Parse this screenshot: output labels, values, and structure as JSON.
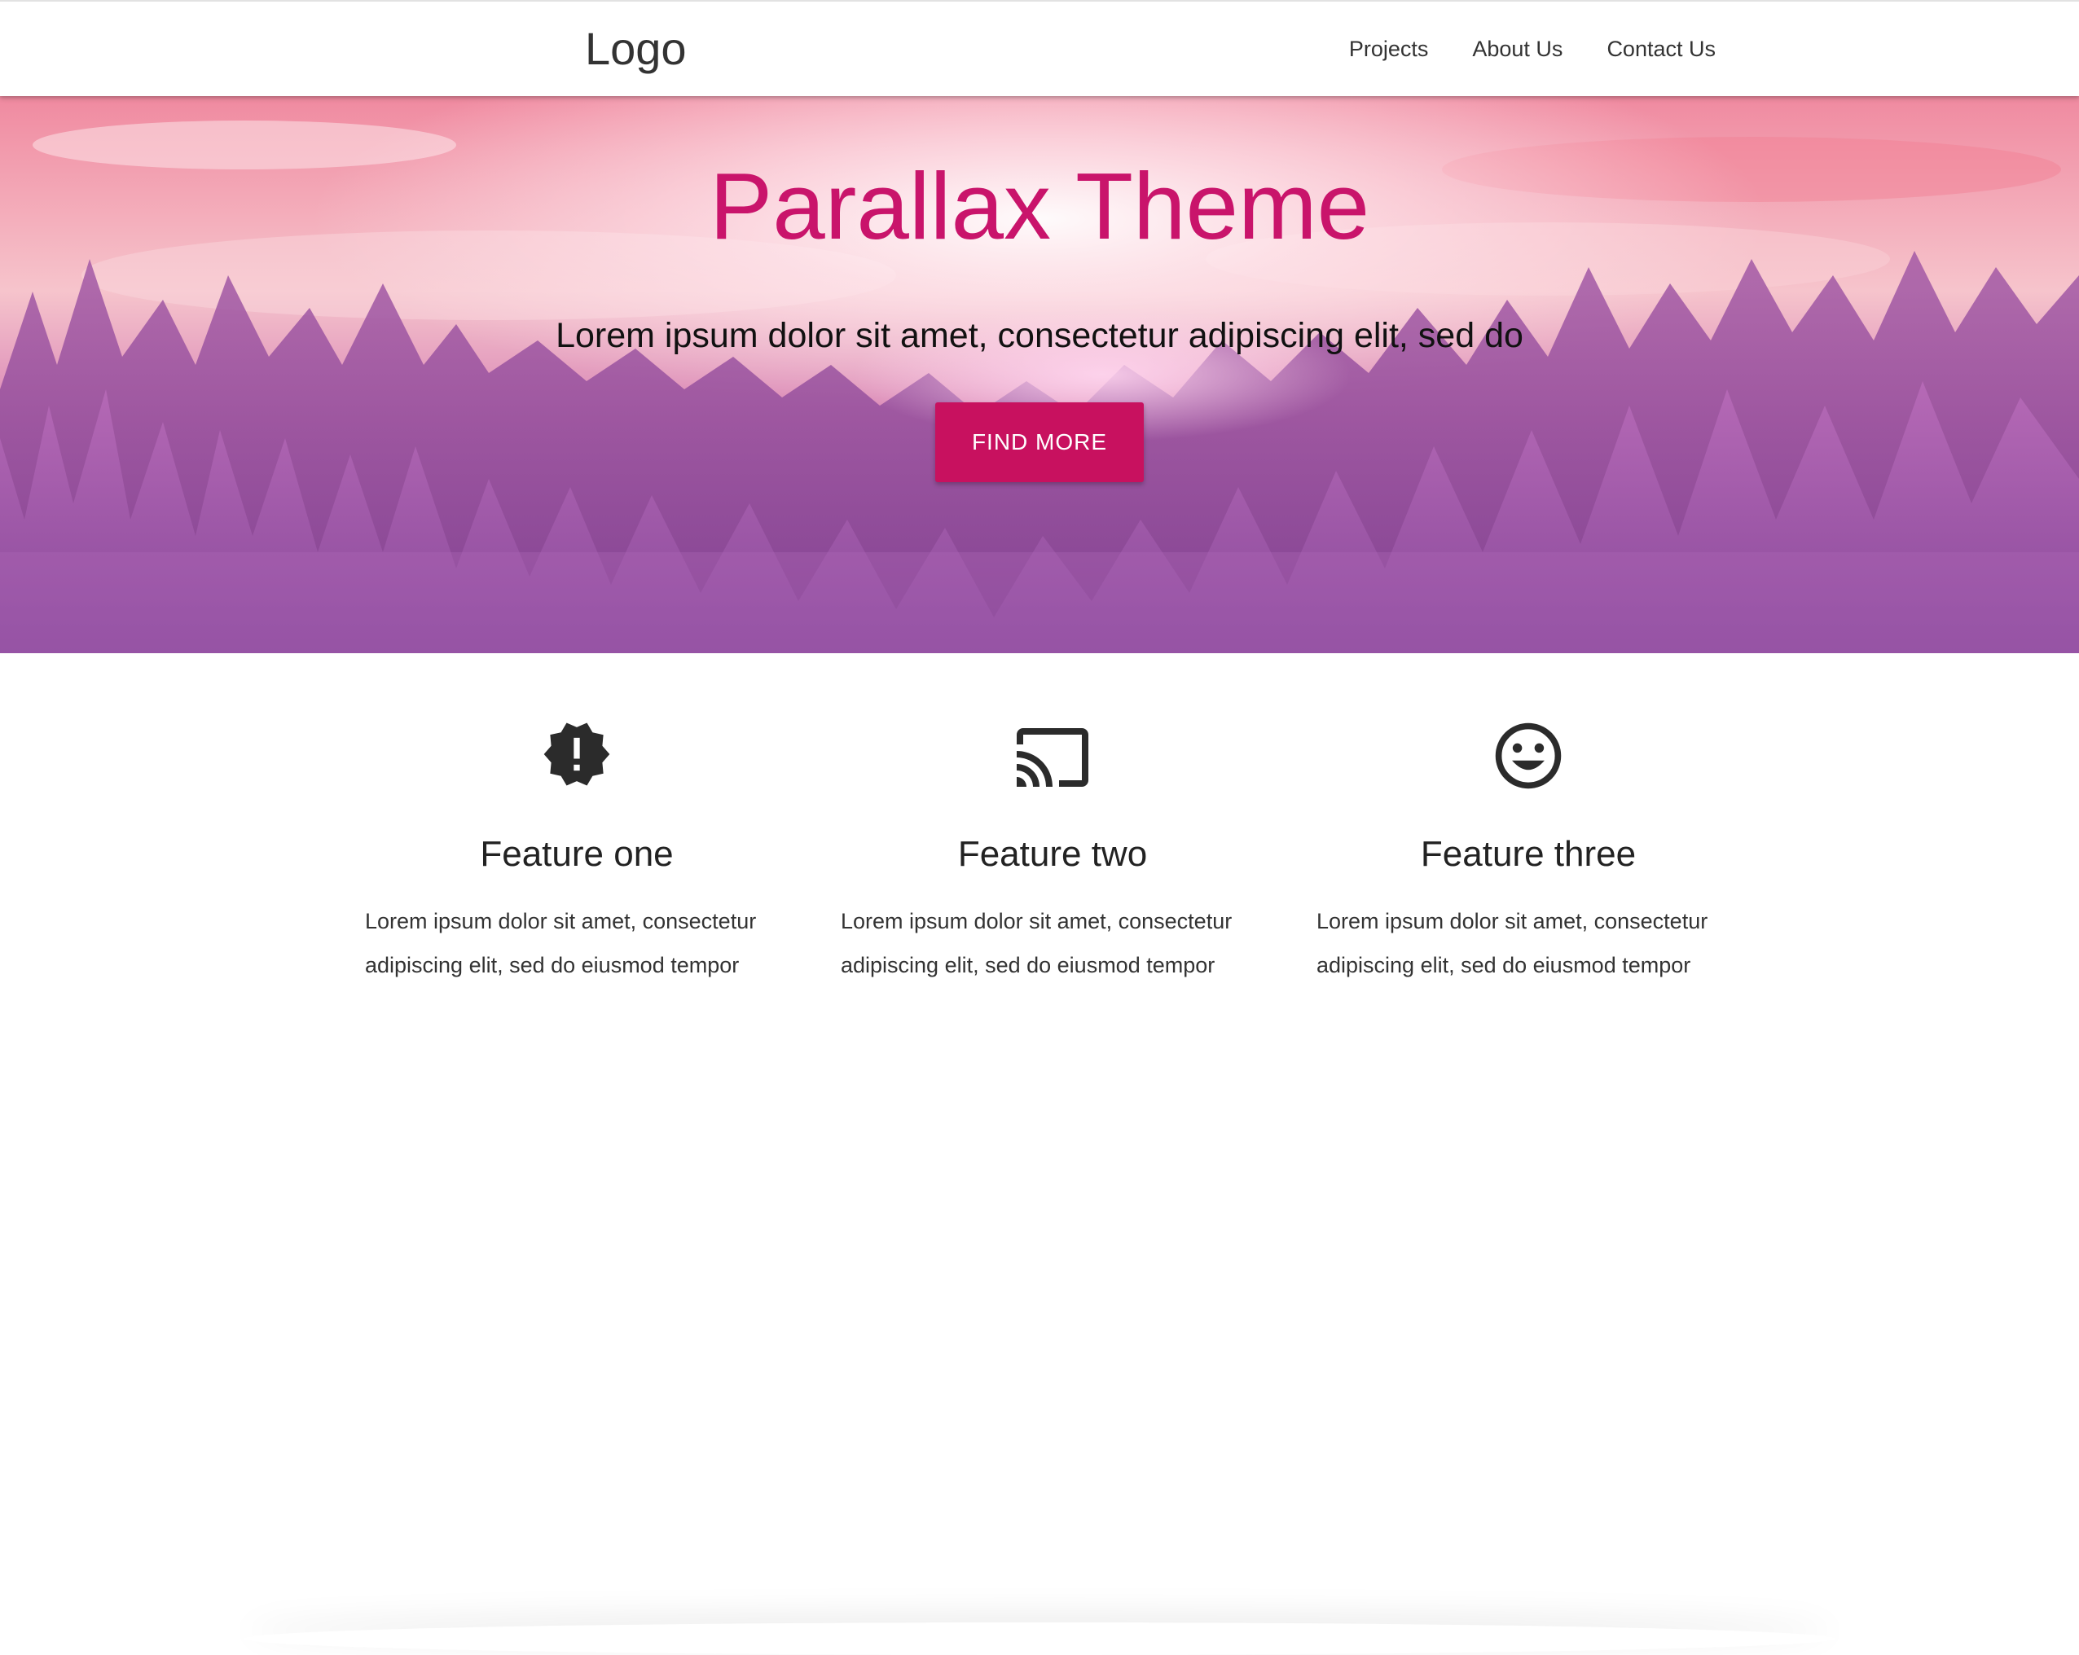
{
  "nav": {
    "logo": "Logo",
    "links": [
      "Projects",
      "About Us",
      "Contact Us"
    ]
  },
  "hero": {
    "title": "Parallax Theme",
    "subtitle": "Lorem ipsum dolor sit amet, consectetur adipiscing elit, sed do",
    "button": "FIND MORE"
  },
  "features": [
    {
      "icon": "new-releases-icon",
      "title": "Feature one",
      "text": "Lorem ipsum dolor sit amet, consectetur adipiscing elit, sed do eiusmod tempor"
    },
    {
      "icon": "cast-icon",
      "title": "Feature two",
      "text": "Lorem ipsum dolor sit amet, consectetur adipiscing elit, sed do eiusmod tempor"
    },
    {
      "icon": "smiley-face-icon",
      "title": "Feature three",
      "text": "Lorem ipsum dolor sit amet, consectetur adipiscing elit, sed do eiusmod tempor"
    }
  ],
  "colors": {
    "accent": "#c8115f",
    "title_pink": "#c9146b",
    "text_dark": "#333333"
  }
}
